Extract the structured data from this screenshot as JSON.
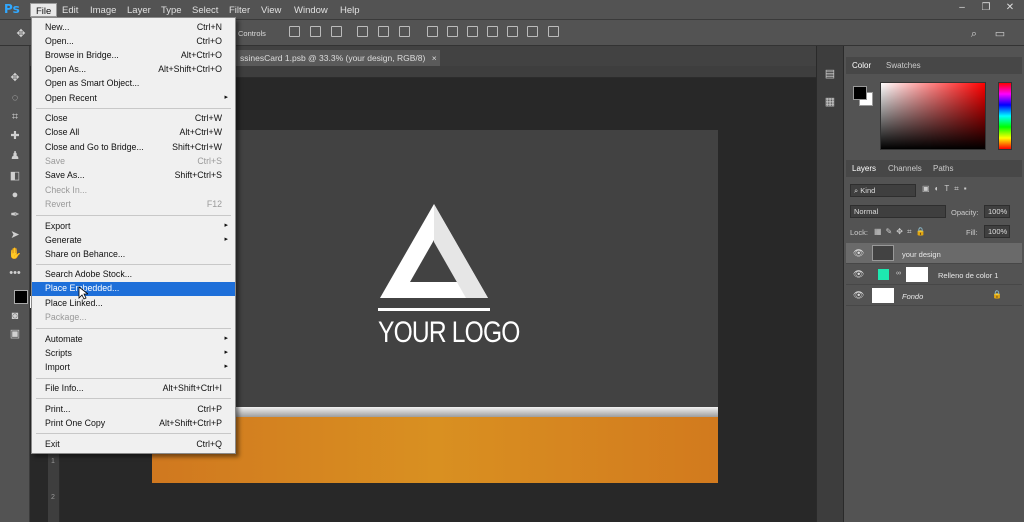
{
  "app": {
    "logo": "Ps"
  },
  "menubar": [
    "File",
    "Edit",
    "Image",
    "Layer",
    "Type",
    "Select",
    "Filter",
    "View",
    "Window",
    "Help"
  ],
  "options_bar": {
    "controls_label": "Controls"
  },
  "document": {
    "tab_title": "ssinesCard 1.psb @ 33.3% (your design, RGB/8)",
    "tab_close": "×",
    "logo_text": "YOUR LOGO",
    "ruler_left": [
      "1",
      "2"
    ]
  },
  "file_menu": {
    "items": [
      {
        "label": "New...",
        "shortcut": "Ctrl+N"
      },
      {
        "label": "Open...",
        "shortcut": "Ctrl+O"
      },
      {
        "label": "Browse in Bridge...",
        "shortcut": "Alt+Ctrl+O"
      },
      {
        "label": "Open As...",
        "shortcut": "Alt+Shift+Ctrl+O"
      },
      {
        "label": "Open as Smart Object...",
        "shortcut": ""
      },
      {
        "label": "Open Recent",
        "shortcut": ""
      },
      {
        "label": "Close",
        "shortcut": "Ctrl+W"
      },
      {
        "label": "Close All",
        "shortcut": "Alt+Ctrl+W"
      },
      {
        "label": "Close and Go to Bridge...",
        "shortcut": "Shift+Ctrl+W"
      },
      {
        "label": "Save",
        "shortcut": "Ctrl+S"
      },
      {
        "label": "Save As...",
        "shortcut": "Shift+Ctrl+S"
      },
      {
        "label": "Check In...",
        "shortcut": ""
      },
      {
        "label": "Revert",
        "shortcut": "F12"
      },
      {
        "label": "Export",
        "shortcut": ""
      },
      {
        "label": "Generate",
        "shortcut": ""
      },
      {
        "label": "Share on Behance...",
        "shortcut": ""
      },
      {
        "label": "Search Adobe Stock...",
        "shortcut": ""
      },
      {
        "label": "Place Embedded...",
        "shortcut": ""
      },
      {
        "label": "Place Linked...",
        "shortcut": ""
      },
      {
        "label": "Package...",
        "shortcut": ""
      },
      {
        "label": "Automate",
        "shortcut": ""
      },
      {
        "label": "Scripts",
        "shortcut": ""
      },
      {
        "label": "Import",
        "shortcut": ""
      },
      {
        "label": "File Info...",
        "shortcut": "Alt+Shift+Ctrl+I"
      },
      {
        "label": "Print...",
        "shortcut": "Ctrl+P"
      },
      {
        "label": "Print One Copy",
        "shortcut": "Alt+Shift+Ctrl+P"
      },
      {
        "label": "Exit",
        "shortcut": "Ctrl+Q"
      }
    ],
    "submenu_arrow": "▸"
  },
  "color_panel": {
    "tabs": [
      "Color",
      "Swatches"
    ],
    "foreground": "#000000",
    "background": "#ffffff"
  },
  "layers_panel": {
    "tabs": [
      "Layers",
      "Channels",
      "Paths"
    ],
    "filter": "Kind",
    "blend_mode": "Normal",
    "opacity_label": "Opacity:",
    "opacity_value": "100%",
    "lock_label": "Lock:",
    "fill_label": "Fill:",
    "fill_value": "100%",
    "layers": [
      {
        "name": "your design"
      },
      {
        "name": "Relleno de color 1",
        "fill": "#1ee8b0"
      },
      {
        "name": "Fondo"
      }
    ]
  },
  "colors": {
    "accent": "#1e6fd9",
    "orange": "#d8861f",
    "canvas": "#424242"
  }
}
